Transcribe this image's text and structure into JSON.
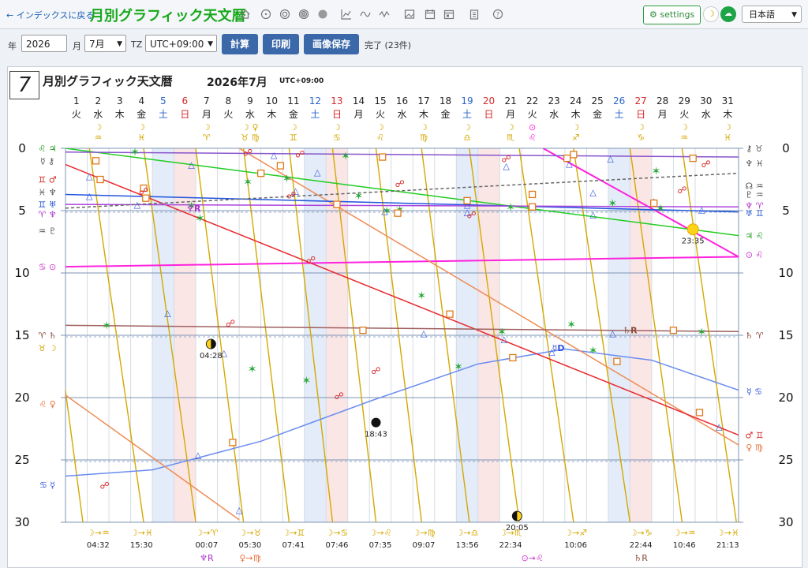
{
  "header": {
    "back_link": "← インデックスに戻る",
    "title": "月別グラフィック天文暦",
    "toolbar_icons": [
      "home-icon",
      "sun-icon",
      "target-icon",
      "rings-icon",
      "disc-icon",
      "line-chart-icon",
      "wave-icon",
      "zigzag-icon",
      "image-icon",
      "calendar-icon",
      "calendar-alt-icon",
      "clipboard-icon",
      "help-icon"
    ],
    "settings_label": "⚙ settings",
    "language": "日本語"
  },
  "controls": {
    "year_label": "年",
    "year_value": "2026",
    "month_label": "月",
    "month_value": "7月",
    "tz_label": "TZ",
    "tz_value": "UTC+09:00",
    "calc_button": "計算",
    "print_button": "印刷",
    "save_button": "画像保存",
    "status": "完了 (23件)"
  },
  "card": {
    "month_number": "7",
    "title": "月別グラフィック天文暦",
    "year_month": "2026年7月",
    "tz": "UTC+09:00"
  },
  "calendar": {
    "days": [
      "1",
      "2",
      "3",
      "4",
      "5",
      "6",
      "7",
      "8",
      "9",
      "10",
      "11",
      "12",
      "13",
      "14",
      "15",
      "16",
      "17",
      "18",
      "19",
      "20",
      "21",
      "22",
      "23",
      "24",
      "25",
      "26",
      "27",
      "28",
      "29",
      "30",
      "31"
    ],
    "weekdays": [
      "火",
      "水",
      "木",
      "金",
      "土",
      "日",
      "月",
      "火",
      "水",
      "木",
      "金",
      "土",
      "日",
      "月",
      "火",
      "水",
      "木",
      "金",
      "土",
      "日",
      "月",
      "火",
      "水",
      "木",
      "金",
      "土",
      "日",
      "月",
      "火",
      "水",
      "木"
    ],
    "day_colors": {
      "sat": "#2a64c8",
      "sun": "#d62828",
      "normal": "#222"
    },
    "ingress_top": [
      {
        "day": 2,
        "sym": "☽\n♒"
      },
      {
        "day": 4,
        "sym": "☽\n♓"
      },
      {
        "day": 7,
        "sym": "☽\n♈"
      },
      {
        "day": 9,
        "sym": "☽ ♀\n♉ ♍"
      },
      {
        "day": 11,
        "sym": "☽\n♊"
      },
      {
        "day": 13,
        "sym": "☽\n♋"
      },
      {
        "day": 15,
        "sym": "☽\n♌"
      },
      {
        "day": 17,
        "sym": "☽\n♍"
      },
      {
        "day": 19,
        "sym": "☽\n♎"
      },
      {
        "day": 21,
        "sym": "☽\n♏"
      },
      {
        "day": 22,
        "sym": "⊙\n♌"
      },
      {
        "day": 24,
        "sym": "☽\n♐"
      },
      {
        "day": 27,
        "sym": "☽\n♑"
      },
      {
        "day": 29,
        "sym": "☽\n♒"
      },
      {
        "day": 31,
        "sym": "☽\n♓"
      }
    ]
  },
  "axis": {
    "y_ticks": [
      "0",
      "5",
      "10",
      "15",
      "20",
      "25",
      "30"
    ]
  },
  "left_labels": [
    {
      "deg": 0,
      "text": "♌ ♃",
      "color": "#229922"
    },
    {
      "deg": 1,
      "text": "☿ ⚷",
      "color": "#555"
    },
    {
      "deg": 2.5,
      "text": "♊ ♂",
      "color": "#d62828"
    },
    {
      "deg": 3.5,
      "text": "♓ ♆",
      "color": "#555"
    },
    {
      "deg": 4.5,
      "text": "♊ ♅",
      "color": "#2255cc"
    },
    {
      "deg": 5.3,
      "text": "♈ ♆",
      "color": "#aa33cc"
    },
    {
      "deg": 6.6,
      "text": "♒ ♇",
      "color": "#555"
    },
    {
      "deg": 9.5,
      "text": "♋ ⊙",
      "color": "#cc33cc"
    },
    {
      "deg": 15,
      "text": "♈ ♄",
      "color": "#8a4a3a"
    },
    {
      "deg": 16,
      "text": "♉ ☽",
      "color": "#d4a000"
    },
    {
      "deg": 20.5,
      "text": "♌ ♀",
      "color": "#e8703a"
    },
    {
      "deg": 27,
      "text": "♋ ☿",
      "color": "#3355dd"
    }
  ],
  "right_labels": [
    {
      "deg": 0,
      "text": "⚷ ♉",
      "color": "#555"
    },
    {
      "deg": 1.2,
      "text": "♆ ♓",
      "color": "#555"
    },
    {
      "deg": 3,
      "text": "☊ ♒",
      "color": "#555"
    },
    {
      "deg": 3.7,
      "text": "♇ ♒",
      "color": "#555"
    },
    {
      "deg": 4.6,
      "text": "♆ ♈",
      "color": "#aa33cc"
    },
    {
      "deg": 5.2,
      "text": "♅ ♊",
      "color": "#2255cc"
    },
    {
      "deg": 7,
      "text": "♃ ♌",
      "color": "#229922"
    },
    {
      "deg": 8.5,
      "text": "⊙ ♌",
      "color": "#cc33cc"
    },
    {
      "deg": 15,
      "text": "♄ ♈",
      "color": "#8a4a3a"
    },
    {
      "deg": 19.5,
      "text": "☿ ♋",
      "color": "#3355dd"
    },
    {
      "deg": 23,
      "text": "♂ ♊",
      "color": "#d62828"
    },
    {
      "deg": 24,
      "text": "♀ ♍",
      "color": "#e8703a"
    }
  ],
  "events": {
    "retro": [
      {
        "text": "♆R",
        "day": 6.9,
        "deg": 4.8,
        "color": "#aa33cc"
      },
      {
        "text": "♄R",
        "day": 27,
        "deg": 14.6,
        "color": "#8a4a3a"
      },
      {
        "text": "☿D",
        "day": 23.7,
        "deg": 16,
        "color": "#3355dd"
      }
    ],
    "lunar_phases": [
      {
        "day": 7.7,
        "deg": 15.7,
        "time": "04:28",
        "phase": "last-quarter"
      },
      {
        "day": 15.3,
        "deg": 22,
        "time": "18:43",
        "phase": "new"
      },
      {
        "day": 21.8,
        "deg": 29.5,
        "time": "20:05",
        "phase": "first-quarter"
      },
      {
        "day": 29.9,
        "deg": 6.5,
        "time": "23:35",
        "phase": "full"
      }
    ]
  },
  "bottom_ingress": [
    {
      "day": 2,
      "sym": "☽→♒",
      "time": "04:32"
    },
    {
      "day": 4,
      "sym": "☽→♓",
      "time": "15:30"
    },
    {
      "day": 7,
      "sym": "☽→♈",
      "time": "00:07"
    },
    {
      "day": 9,
      "sym": "☽→♉",
      "time": "05:30"
    },
    {
      "day": 11,
      "sym": "☽→♊",
      "time": "07:41"
    },
    {
      "day": 13,
      "sym": "☽→♋",
      "time": "07:46"
    },
    {
      "day": 15,
      "sym": "☽→♌",
      "time": "07:35"
    },
    {
      "day": 17,
      "sym": "☽→♍",
      "time": "09:07"
    },
    {
      "day": 19,
      "sym": "☽→♎",
      "time": "13:56"
    },
    {
      "day": 21,
      "sym": "☽→♏",
      "time": "22:34"
    },
    {
      "day": 24,
      "sym": "☽→♐",
      "time": "10:06"
    },
    {
      "day": 27,
      "sym": "☽→♑",
      "time": "22:44"
    },
    {
      "day": 29,
      "sym": "☽→♒",
      "time": "10:46"
    },
    {
      "day": 31,
      "sym": "☽→♓",
      "time": "21:13"
    }
  ],
  "bottom_extra": [
    {
      "day": 7,
      "text": "♆R",
      "color": "#aa33cc"
    },
    {
      "day": 9,
      "text": "♀→♍",
      "color": "#e8703a"
    },
    {
      "day": 22,
      "text": "⊙→♌",
      "color": "#cc33cc"
    },
    {
      "day": 27,
      "text": "♄R",
      "color": "#8a4a3a"
    }
  ],
  "colors": {
    "moon": "#d4a800",
    "sun": "#ff22dd",
    "mercury": "#6b8cf0",
    "venus": "#ee8c55",
    "mars": "#e8282e",
    "jupiter": "#22cc22",
    "saturn": "#a06060",
    "uranus": "#2255dd",
    "neptune": "#aa44dd",
    "pluto": "#666666",
    "node": "#8855cc",
    "chiron": "#999999"
  },
  "chart_data": {
    "type": "line",
    "title": "月別グラフィック天文暦",
    "xlabel": "",
    "ylabel": "",
    "x_range": [
      1,
      32
    ],
    "ylim": [
      0,
      30
    ],
    "series": [
      {
        "key": "sun",
        "points": [
          [
            1,
            9.5
          ],
          [
            32,
            8.7
          ]
        ]
      },
      {
        "key": "sun_wrap",
        "points": [
          [
            23,
            0
          ],
          [
            32,
            8.7
          ]
        ]
      },
      {
        "key": "mercury",
        "points": [
          [
            1,
            26.3
          ],
          [
            5,
            25.8
          ],
          [
            10,
            23.5
          ],
          [
            15,
            20.3
          ],
          [
            20,
            17.3
          ],
          [
            24,
            16.1
          ],
          [
            28,
            17.0
          ],
          [
            32,
            19.4
          ]
        ]
      },
      {
        "key": "venus",
        "points": [
          [
            1,
            19.8
          ],
          [
            9,
            29.8
          ]
        ]
      },
      {
        "key": "venus2",
        "points": [
          [
            9,
            0
          ],
          [
            32,
            23.8
          ]
        ]
      },
      {
        "key": "mars",
        "points": [
          [
            1,
            1.3
          ],
          [
            32,
            23.0
          ]
        ]
      },
      {
        "key": "jupiter",
        "points": [
          [
            1,
            0
          ],
          [
            32,
            7.0
          ]
        ]
      },
      {
        "key": "saturn",
        "points": [
          [
            1,
            14.2
          ],
          [
            32,
            14.7
          ]
        ]
      },
      {
        "key": "uranus",
        "points": [
          [
            1,
            3.7
          ],
          [
            32,
            5.1
          ]
        ]
      },
      {
        "key": "neptune",
        "points": [
          [
            1,
            4.5
          ],
          [
            32,
            4.7
          ]
        ]
      },
      {
        "key": "pluto",
        "points": [
          [
            1,
            4.8
          ],
          [
            32,
            2.0
          ]
        ]
      },
      {
        "key": "node",
        "points": [
          [
            1,
            0.3
          ],
          [
            32,
            0.7
          ]
        ]
      }
    ],
    "moon_segments": [
      [
        [
          0.7,
          15.5
        ],
        [
          1.8,
          30
        ]
      ],
      [
        [
          2.1,
          0
        ],
        [
          4.6,
          30
        ]
      ],
      [
        [
          4.6,
          0
        ],
        [
          7.0,
          30
        ]
      ],
      [
        [
          7.0,
          0
        ],
        [
          9.2,
          30
        ]
      ],
      [
        [
          9.2,
          0
        ],
        [
          11.3,
          30
        ]
      ],
      [
        [
          11.3,
          0
        ],
        [
          13.3,
          30
        ]
      ],
      [
        [
          13.3,
          0
        ],
        [
          15.3,
          30
        ]
      ],
      [
        [
          15.3,
          0
        ],
        [
          17.4,
          30
        ]
      ],
      [
        [
          17.4,
          0
        ],
        [
          19.6,
          30
        ]
      ],
      [
        [
          19.6,
          0
        ],
        [
          21.9,
          30
        ]
      ],
      [
        [
          21.9,
          0
        ],
        [
          24.4,
          30
        ]
      ],
      [
        [
          24.4,
          0
        ],
        [
          27.0,
          30
        ]
      ],
      [
        [
          27.0,
          0
        ],
        [
          29.4,
          30
        ]
      ],
      [
        [
          29.4,
          0
        ],
        [
          31.9,
          30
        ]
      ]
    ]
  }
}
